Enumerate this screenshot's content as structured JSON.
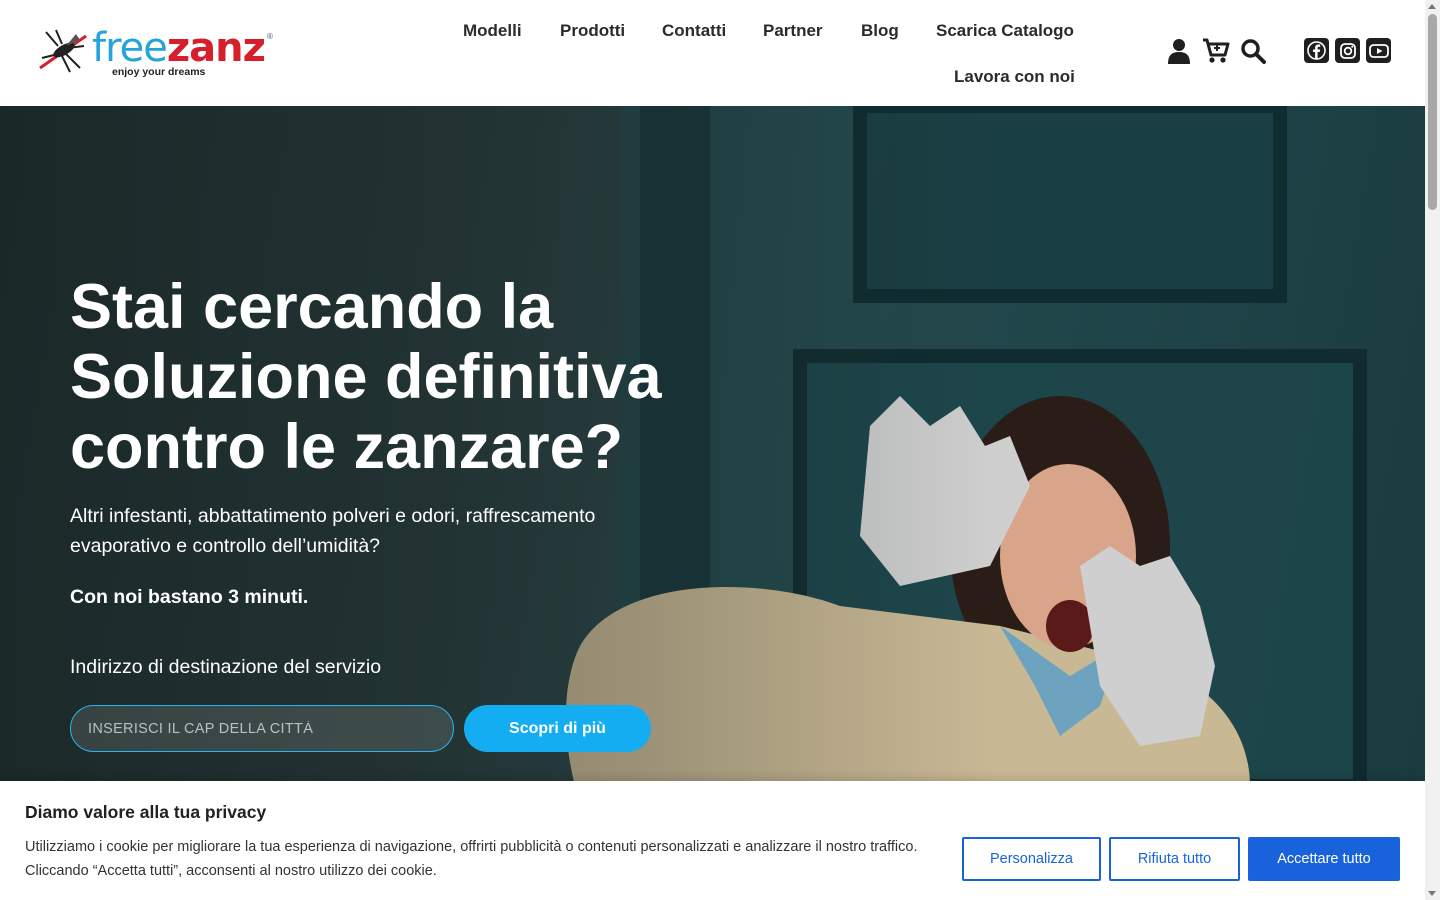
{
  "brand": {
    "name_part1": "free",
    "name_part2": "zanz",
    "registered": "®",
    "tagline": "enjoy your dreams"
  },
  "nav": {
    "items": [
      {
        "label": "Modelli"
      },
      {
        "label": "Prodotti"
      },
      {
        "label": "Contatti"
      },
      {
        "label": "Partner"
      },
      {
        "label": "Blog"
      },
      {
        "label": "Scarica Catalogo"
      },
      {
        "label": "Lavora con noi"
      }
    ]
  },
  "header_icons": [
    "user-icon",
    "cart-icon",
    "search-icon"
  ],
  "social": [
    "facebook-icon",
    "instagram-icon",
    "youtube-icon"
  ],
  "hero": {
    "title_line1": "Stai cercando la",
    "title_line2": "Soluzione definitiva",
    "title_line3": "contro le zanzare?",
    "subtitle": "Altri infestanti, abbattatimento polveri e odori, raffrescamento evaporativo e controllo dell’umidità?",
    "strong": "Con noi bastano 3 minuti.",
    "field_label": "Indirizzo di destinazione del servizio",
    "cap_placeholder": "INSERISCI IL CAP DELLA CITTÀ",
    "cta": "Scopri di più"
  },
  "cookie": {
    "title": "Diamo valore alla tua privacy",
    "line1": "Utilizziamo i cookie per migliorare la tua esperienza di navigazione, offrirti pubblicità o contenuti personalizzati e analizzare il nostro traffico.",
    "line2": "Cliccando “Accetta tutti”, acconsenti al nostro utilizzo dei cookie.",
    "customize": "Personalizza",
    "reject": "Rifiuta tutto",
    "accept": "Accettare tutto"
  },
  "colors": {
    "brand_blue": "#27a3dc",
    "brand_red": "#d61f2b",
    "cta_blue": "#14adf2",
    "cookie_blue": "#1863dc"
  }
}
